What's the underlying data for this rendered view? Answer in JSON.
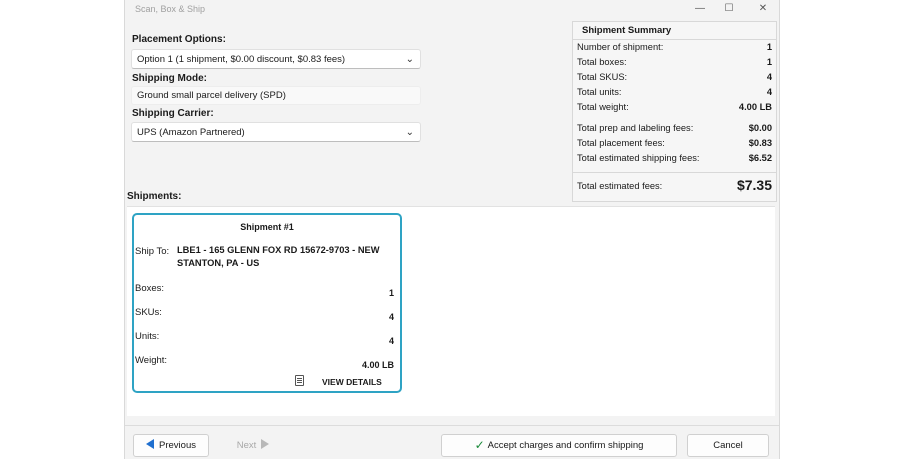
{
  "window": {
    "title": "Scan, Box & Ship",
    "min_glyph": "—",
    "max_glyph": "☐",
    "close_glyph": "✕"
  },
  "placement": {
    "label": "Placement Options:",
    "value": "Option 1 (1 shipment, $0.00 discount, $0.83 fees)"
  },
  "shipping_mode": {
    "label": "Shipping Mode:",
    "value": "Ground small parcel delivery (SPD)"
  },
  "carrier": {
    "label": "Shipping Carrier:",
    "value": "UPS (Amazon Partnered)"
  },
  "summary": {
    "title": "Shipment Summary",
    "rows": [
      {
        "label": "Number of shipment:",
        "value": "1"
      },
      {
        "label": "Total boxes:",
        "value": "1"
      },
      {
        "label": "Total SKUS:",
        "value": "4"
      },
      {
        "label": "Total units:",
        "value": "4"
      },
      {
        "label": "Total weight:",
        "value": "4.00 LB"
      }
    ],
    "fees": [
      {
        "label": "Total prep and labeling fees:",
        "value": "$0.00"
      },
      {
        "label": "Total placement fees:",
        "value": "$0.83"
      },
      {
        "label": "Total estimated shipping fees:",
        "value": "$6.52"
      }
    ],
    "total": {
      "label": "Total estimated fees:",
      "value": "$7.35"
    }
  },
  "shipments": {
    "label": "Shipments:",
    "cards": [
      {
        "title": "Shipment #1",
        "ship_to_label": "Ship To:",
        "ship_to": "LBE1 - 165 GLENN FOX RD 15672-9703 - NEW STANTON, PA - US",
        "boxes_label": "Boxes:",
        "boxes": "1",
        "skus_label": "SKUs:",
        "skus": "4",
        "units_label": "Units:",
        "units": "4",
        "weight_label": "Weight:",
        "weight": "4.00 LB",
        "view_details": "VIEW DETAILS"
      }
    ]
  },
  "footer": {
    "previous": "Previous",
    "next": "Next",
    "accept": "Accept charges and confirm shipping",
    "cancel": "Cancel"
  },
  "colors": {
    "accent": "#2ea3c4",
    "nav_arrow": "#1f6fcf",
    "check": "#1a8a3a"
  }
}
